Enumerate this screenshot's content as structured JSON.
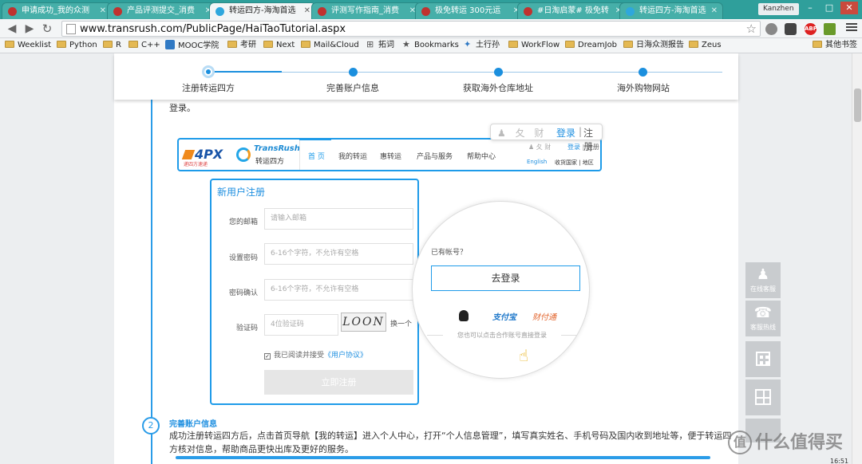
{
  "browser": {
    "tabs": [
      {
        "title": "申请成功_我的众测",
        "icon": "red"
      },
      {
        "title": "产品评测提交_消费",
        "icon": "red"
      },
      {
        "title": "转运四方-海淘首选",
        "icon": "blue",
        "active": true
      },
      {
        "title": "评测写作指南_消费",
        "icon": "red"
      },
      {
        "title": "极免转运 300元运",
        "icon": "red"
      },
      {
        "title": "#日淘启蒙# 极免转",
        "icon": "red"
      },
      {
        "title": "转运四方-海淘首选",
        "icon": "blue"
      }
    ],
    "user_badge": "Kanzhen",
    "url": "www.transrush.com/PublicPage/HaiTaoTutorial.aspx",
    "bookmarks": [
      {
        "label": "Weeklist",
        "icon": "folder"
      },
      {
        "label": "Python",
        "icon": "folder"
      },
      {
        "label": "R",
        "icon": "folder"
      },
      {
        "label": "C++",
        "icon": "folder"
      },
      {
        "label": "MOOC学院",
        "icon": "mooc"
      },
      {
        "label": "考研",
        "icon": "folder"
      },
      {
        "label": "Next",
        "icon": "folder"
      },
      {
        "label": "Mail&Cloud",
        "icon": "folder"
      },
      {
        "label": "拓词",
        "icon": "site"
      },
      {
        "label": "Bookmarks",
        "icon": "star"
      },
      {
        "label": "土行孙",
        "icon": "site"
      },
      {
        "label": "WorkFlow",
        "icon": "folder"
      },
      {
        "label": "DreamJob",
        "icon": "folder"
      },
      {
        "label": "日海众测报告",
        "icon": "folder"
      },
      {
        "label": "Zeus",
        "icon": "folder"
      },
      {
        "label": "其他书签",
        "icon": "folder"
      }
    ]
  },
  "steps": [
    "注册转运四方",
    "完善账户信息",
    "获取海外仓库地址",
    "海外购物网站"
  ],
  "intro_text": "登录。",
  "site": {
    "logo_4px": "4PX",
    "logo_4px_sub": "递四方速递",
    "logo_transrush_en": "TransRush",
    "logo_transrush_cn": "转运四方",
    "nav": [
      "首 页",
      "我的转运",
      "惠转运",
      "产品与服务",
      "帮助中心"
    ],
    "mini_login": "登录",
    "mini_register": "注册",
    "english": "English",
    "country": "收货国家 | 地区"
  },
  "bubble": {
    "login": "登录",
    "sep": "|",
    "register": "注册"
  },
  "register_form": {
    "title": "新用户注册",
    "fields": [
      {
        "label": "您的邮箱",
        "placeholder": "请输入邮箱"
      },
      {
        "label": "设置密码",
        "placeholder": "6-16个字符，不允许有空格"
      },
      {
        "label": "密码确认",
        "placeholder": "6-16个字符，不允许有空格"
      },
      {
        "label": "验证码",
        "placeholder": "4位验证码"
      }
    ],
    "captcha": "LOON",
    "change": "换一个",
    "agree_text": "我已阅读并接受",
    "agree_link": "《用户协议》",
    "submit": "立即注册"
  },
  "zoom": {
    "has_account": "已有帐号？",
    "go_login": "去登录",
    "alipay": "支付宝",
    "caifu": "财付通",
    "tip": "您也可以点击合作账号直接登录"
  },
  "section2": {
    "number": "2",
    "title": "完善账户信息",
    "body": "成功注册转运四方后，点击首页导航【我的转运】进入个人中心，打开“个人信息管理”，填写真实姓名、手机号码及国内收到地址等，便于转运四方核对信息，帮助商品更快出库及更好的服务。"
  },
  "float_panel": [
    {
      "label": "在线客服",
      "icon": "chat-icon"
    },
    {
      "label": "客服热线",
      "icon": "headset-icon"
    },
    {
      "label": "",
      "icon": "qrcode-icon"
    },
    {
      "label": "",
      "icon": "calculator-icon"
    }
  ],
  "watermark": "值 什么值得买",
  "colors": {
    "accent": "#1e9be9",
    "tabbar": "#2f9f9b"
  }
}
